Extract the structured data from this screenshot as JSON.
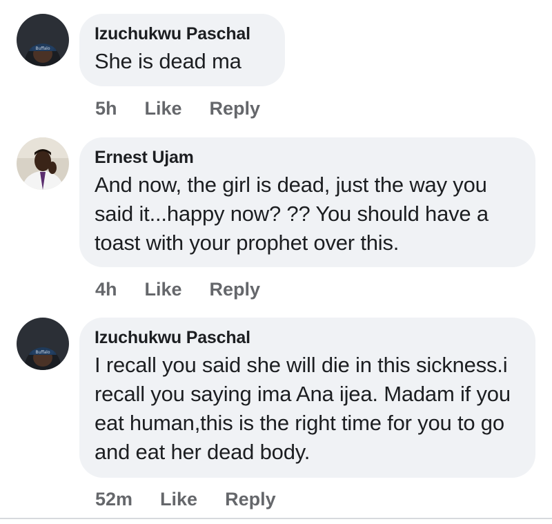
{
  "comments": [
    {
      "author": "Izuchukwu Paschal",
      "text": "She is dead ma",
      "time": "5h",
      "like_label": "Like",
      "reply_label": "Reply",
      "avatar_icon": "profile-photo-cap-man"
    },
    {
      "author": "Ernest Ujam",
      "text": "And now, the girl is dead, just the way you said it...happy now? ?? You should have a toast with your prophet over this.",
      "time": "4h",
      "like_label": "Like",
      "reply_label": "Reply",
      "avatar_icon": "profile-photo-suit-man"
    },
    {
      "author": "Izuchukwu Paschal",
      "text": "I recall you said she will die in this sickness.i recall you saying ima Ana ijea. Madam if you eat human,this is the right time for you to go and eat her dead body.",
      "time": "52m",
      "like_label": "Like",
      "reply_label": "Reply",
      "avatar_icon": "profile-photo-cap-man"
    }
  ],
  "colors": {
    "bubble_bg": "#f0f2f5",
    "text": "#1c1e21",
    "meta": "#65676b"
  }
}
